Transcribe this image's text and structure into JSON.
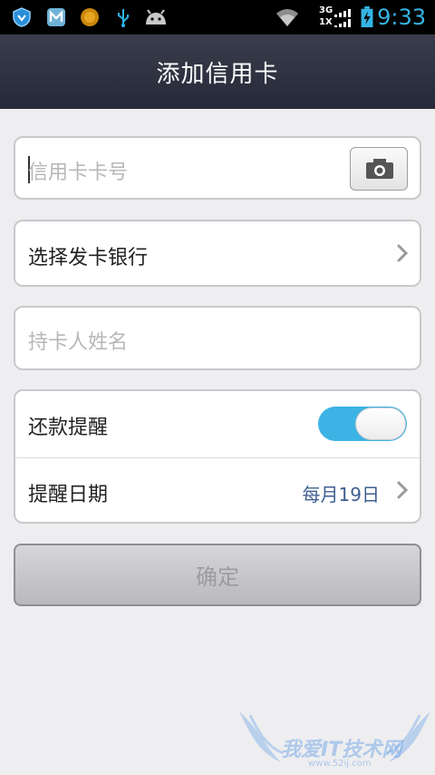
{
  "status_bar": {
    "time": "9:33",
    "network_top": "3G",
    "network_bottom": "1X",
    "icons": [
      "shield-icon",
      "m-app-icon",
      "orange-coin-icon",
      "usb-icon",
      "android-icon",
      "wifi-icon",
      "signal-icon",
      "battery-charging-icon"
    ]
  },
  "header": {
    "title": "添加信用卡"
  },
  "form": {
    "card_number_placeholder": "信用卡卡号",
    "bank_label": "选择发卡银行",
    "holder_placeholder": "持卡人姓名",
    "reminder_label": "还款提醒",
    "reminder_enabled": true,
    "reminder_date_label": "提醒日期",
    "reminder_date_value": "每月19日"
  },
  "confirm_button": {
    "label": "确定"
  },
  "watermark": {
    "text": "我爱IT技术网",
    "url": "www.52ij.com"
  },
  "colors": {
    "accent": "#35b5e5",
    "toggle_on": "#3cb3e4",
    "date_value": "#3d5f91"
  }
}
